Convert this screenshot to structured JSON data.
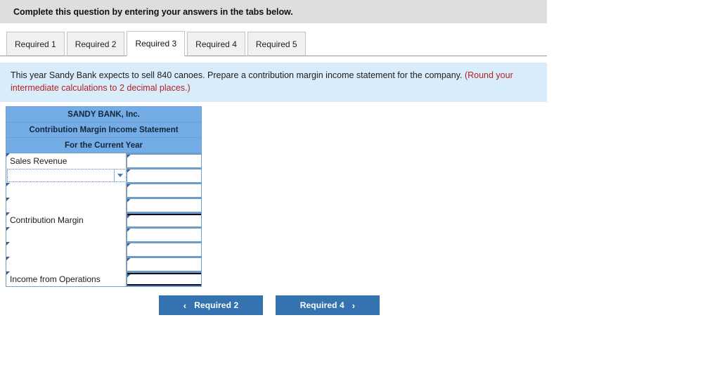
{
  "instruction": {
    "text": "Complete this question by entering your answers in the tabs below."
  },
  "tabs": [
    {
      "label": "Required 1",
      "active": false
    },
    {
      "label": "Required 2",
      "active": false
    },
    {
      "label": "Required 3",
      "active": true
    },
    {
      "label": "Required 4",
      "active": false
    },
    {
      "label": "Required 5",
      "active": false
    }
  ],
  "question": {
    "main": "This year Sandy Bank expects to sell 840 canoes. Prepare a contribution margin income statement for the company.",
    "note": "(Round your intermediate calculations to 2 decimal places.)",
    "note_color": "#b32222"
  },
  "statement": {
    "header_color": "#74ace5",
    "titles": [
      "SANDY BANK, Inc.",
      "Contribution Margin Income Statement",
      "For the Current Year"
    ],
    "rows": [
      {
        "label": "Sales Revenue",
        "value": "",
        "type": "text",
        "value_top_rule": false,
        "value_bottom_rule": false
      },
      {
        "label": "",
        "value": "",
        "type": "dropdown",
        "value_top_rule": false,
        "value_bottom_rule": false
      },
      {
        "label": "",
        "value": "",
        "type": "text",
        "value_top_rule": false,
        "value_bottom_rule": false
      },
      {
        "label": "",
        "value": "",
        "type": "text",
        "value_top_rule": false,
        "value_bottom_rule": false
      },
      {
        "label": "Contribution Margin",
        "value": "",
        "type": "text",
        "value_top_rule": true,
        "value_bottom_rule": false
      },
      {
        "label": "",
        "value": "",
        "type": "text",
        "value_top_rule": false,
        "value_bottom_rule": false
      },
      {
        "label": "",
        "value": "",
        "type": "text",
        "value_top_rule": false,
        "value_bottom_rule": false
      },
      {
        "label": "",
        "value": "",
        "type": "text",
        "value_top_rule": false,
        "value_bottom_rule": false
      },
      {
        "label": "Income from Operations",
        "value": "",
        "type": "text",
        "value_top_rule": true,
        "value_bottom_rule": true
      }
    ]
  },
  "navigation": {
    "prev_label": "Required 2",
    "next_label": "Required 4",
    "prev_icon": "chevron-left-icon",
    "next_icon": "chevron-right-icon",
    "prev_glyph": "‹",
    "next_glyph": "›",
    "button_color": "#3572b0"
  }
}
